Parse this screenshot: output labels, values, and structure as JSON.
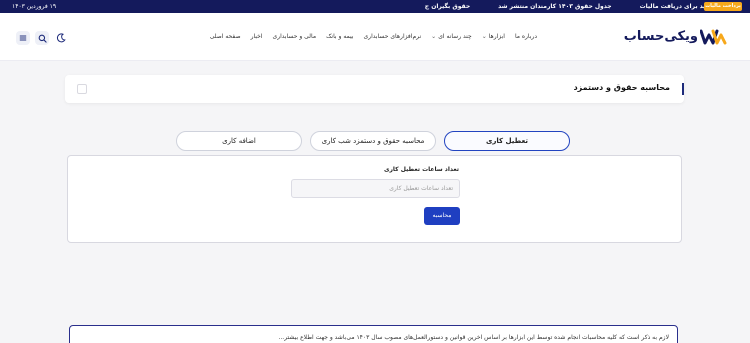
{
  "topbar": {
    "news": [
      "بخشنامه جدید برای دریافت مالیات",
      "جدول حقوق ۱۴۰۳ کارمندان منتشر شد",
      "حقوق بگیران ج"
    ],
    "date": "۱۹ فروردین ۱۴۰۳",
    "cta_label": "پرداخت مالیات",
    "background": "#141a5c",
    "cta_color": "#f7a81b"
  },
  "header": {
    "logo_text": "ویکی‌حساب",
    "nav": [
      {
        "label": "صفحه اصلی",
        "dropdown": false
      },
      {
        "label": "اخبار",
        "dropdown": false
      },
      {
        "label": "مالی و حسابداری",
        "dropdown": false
      },
      {
        "label": "بیمه و بانک",
        "dropdown": false
      },
      {
        "label": "نرم‌افزارهای حسابداری",
        "dropdown": false
      },
      {
        "label": "چند رسانه ای",
        "dropdown": true
      },
      {
        "label": "ابزارها",
        "dropdown": true
      },
      {
        "label": "درباره ما",
        "dropdown": false
      }
    ],
    "icons": [
      "moon-icon",
      "search-icon",
      "menu-icon"
    ]
  },
  "page": {
    "title": "محاسبه حقوق و دستمزد",
    "accent_color": "#1d2a7a"
  },
  "tabs": [
    {
      "label": "تعطیل کاری",
      "active": true
    },
    {
      "label": "محاسبه حقوق و دستمزد شب کاری",
      "active": false
    },
    {
      "label": "اضافه کاری",
      "active": false
    }
  ],
  "form": {
    "field_label": "تعداد ساعات تعطیل کاری",
    "field_value": "",
    "field_placeholder": "تعداد ساعات تعطیل کاری",
    "submit_label": "محاسبه",
    "button_color": "#1f3fc1"
  },
  "description": {
    "text": "لازم به ذکر است که کلیه محاسبات انجام شده توسط این ابزارها بر اساس آخرین قوانین و دستورالعمل‌های مصوب سال ۱۴۰۳ می‌باشد و جهت اطلاع بیشتر..."
  }
}
